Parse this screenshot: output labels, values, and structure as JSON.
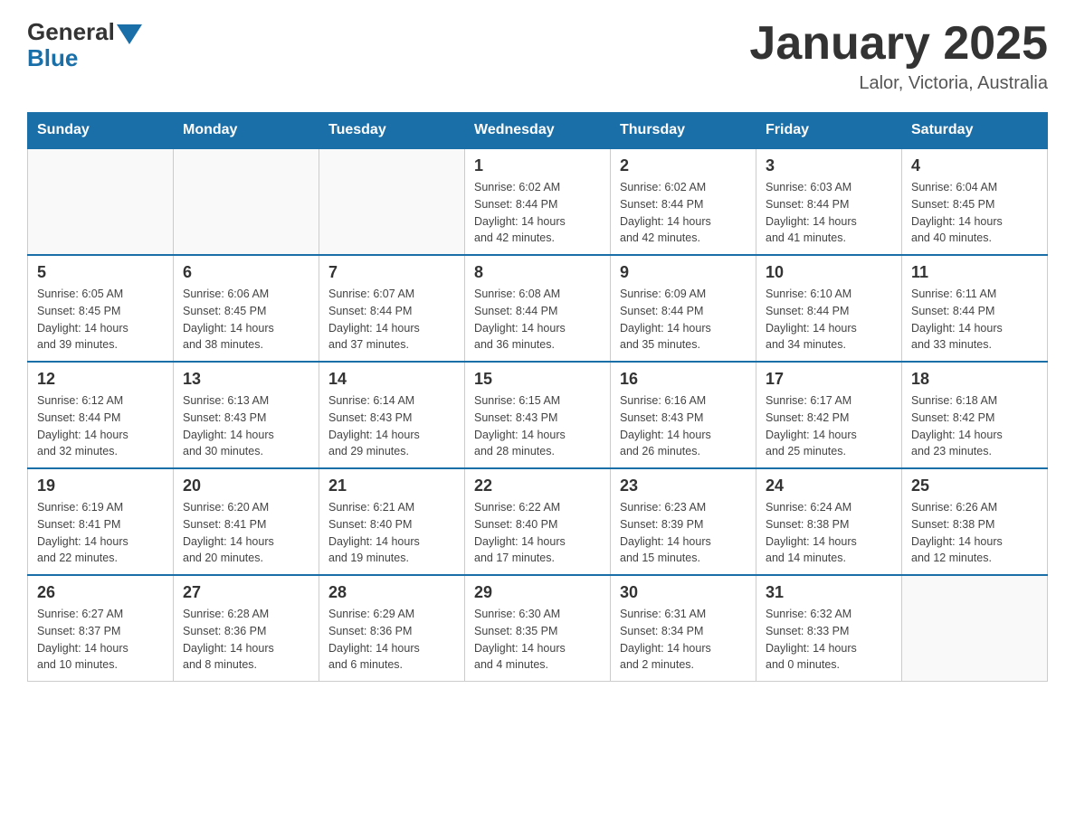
{
  "header": {
    "logo_general": "General",
    "logo_blue": "Blue",
    "title": "January 2025",
    "location": "Lalor, Victoria, Australia"
  },
  "days_of_week": [
    "Sunday",
    "Monday",
    "Tuesday",
    "Wednesday",
    "Thursday",
    "Friday",
    "Saturday"
  ],
  "weeks": [
    [
      {
        "day": "",
        "info": ""
      },
      {
        "day": "",
        "info": ""
      },
      {
        "day": "",
        "info": ""
      },
      {
        "day": "1",
        "info": "Sunrise: 6:02 AM\nSunset: 8:44 PM\nDaylight: 14 hours\nand 42 minutes."
      },
      {
        "day": "2",
        "info": "Sunrise: 6:02 AM\nSunset: 8:44 PM\nDaylight: 14 hours\nand 42 minutes."
      },
      {
        "day": "3",
        "info": "Sunrise: 6:03 AM\nSunset: 8:44 PM\nDaylight: 14 hours\nand 41 minutes."
      },
      {
        "day": "4",
        "info": "Sunrise: 6:04 AM\nSunset: 8:45 PM\nDaylight: 14 hours\nand 40 minutes."
      }
    ],
    [
      {
        "day": "5",
        "info": "Sunrise: 6:05 AM\nSunset: 8:45 PM\nDaylight: 14 hours\nand 39 minutes."
      },
      {
        "day": "6",
        "info": "Sunrise: 6:06 AM\nSunset: 8:45 PM\nDaylight: 14 hours\nand 38 minutes."
      },
      {
        "day": "7",
        "info": "Sunrise: 6:07 AM\nSunset: 8:44 PM\nDaylight: 14 hours\nand 37 minutes."
      },
      {
        "day": "8",
        "info": "Sunrise: 6:08 AM\nSunset: 8:44 PM\nDaylight: 14 hours\nand 36 minutes."
      },
      {
        "day": "9",
        "info": "Sunrise: 6:09 AM\nSunset: 8:44 PM\nDaylight: 14 hours\nand 35 minutes."
      },
      {
        "day": "10",
        "info": "Sunrise: 6:10 AM\nSunset: 8:44 PM\nDaylight: 14 hours\nand 34 minutes."
      },
      {
        "day": "11",
        "info": "Sunrise: 6:11 AM\nSunset: 8:44 PM\nDaylight: 14 hours\nand 33 minutes."
      }
    ],
    [
      {
        "day": "12",
        "info": "Sunrise: 6:12 AM\nSunset: 8:44 PM\nDaylight: 14 hours\nand 32 minutes."
      },
      {
        "day": "13",
        "info": "Sunrise: 6:13 AM\nSunset: 8:43 PM\nDaylight: 14 hours\nand 30 minutes."
      },
      {
        "day": "14",
        "info": "Sunrise: 6:14 AM\nSunset: 8:43 PM\nDaylight: 14 hours\nand 29 minutes."
      },
      {
        "day": "15",
        "info": "Sunrise: 6:15 AM\nSunset: 8:43 PM\nDaylight: 14 hours\nand 28 minutes."
      },
      {
        "day": "16",
        "info": "Sunrise: 6:16 AM\nSunset: 8:43 PM\nDaylight: 14 hours\nand 26 minutes."
      },
      {
        "day": "17",
        "info": "Sunrise: 6:17 AM\nSunset: 8:42 PM\nDaylight: 14 hours\nand 25 minutes."
      },
      {
        "day": "18",
        "info": "Sunrise: 6:18 AM\nSunset: 8:42 PM\nDaylight: 14 hours\nand 23 minutes."
      }
    ],
    [
      {
        "day": "19",
        "info": "Sunrise: 6:19 AM\nSunset: 8:41 PM\nDaylight: 14 hours\nand 22 minutes."
      },
      {
        "day": "20",
        "info": "Sunrise: 6:20 AM\nSunset: 8:41 PM\nDaylight: 14 hours\nand 20 minutes."
      },
      {
        "day": "21",
        "info": "Sunrise: 6:21 AM\nSunset: 8:40 PM\nDaylight: 14 hours\nand 19 minutes."
      },
      {
        "day": "22",
        "info": "Sunrise: 6:22 AM\nSunset: 8:40 PM\nDaylight: 14 hours\nand 17 minutes."
      },
      {
        "day": "23",
        "info": "Sunrise: 6:23 AM\nSunset: 8:39 PM\nDaylight: 14 hours\nand 15 minutes."
      },
      {
        "day": "24",
        "info": "Sunrise: 6:24 AM\nSunset: 8:38 PM\nDaylight: 14 hours\nand 14 minutes."
      },
      {
        "day": "25",
        "info": "Sunrise: 6:26 AM\nSunset: 8:38 PM\nDaylight: 14 hours\nand 12 minutes."
      }
    ],
    [
      {
        "day": "26",
        "info": "Sunrise: 6:27 AM\nSunset: 8:37 PM\nDaylight: 14 hours\nand 10 minutes."
      },
      {
        "day": "27",
        "info": "Sunrise: 6:28 AM\nSunset: 8:36 PM\nDaylight: 14 hours\nand 8 minutes."
      },
      {
        "day": "28",
        "info": "Sunrise: 6:29 AM\nSunset: 8:36 PM\nDaylight: 14 hours\nand 6 minutes."
      },
      {
        "day": "29",
        "info": "Sunrise: 6:30 AM\nSunset: 8:35 PM\nDaylight: 14 hours\nand 4 minutes."
      },
      {
        "day": "30",
        "info": "Sunrise: 6:31 AM\nSunset: 8:34 PM\nDaylight: 14 hours\nand 2 minutes."
      },
      {
        "day": "31",
        "info": "Sunrise: 6:32 AM\nSunset: 8:33 PM\nDaylight: 14 hours\nand 0 minutes."
      },
      {
        "day": "",
        "info": ""
      }
    ]
  ]
}
